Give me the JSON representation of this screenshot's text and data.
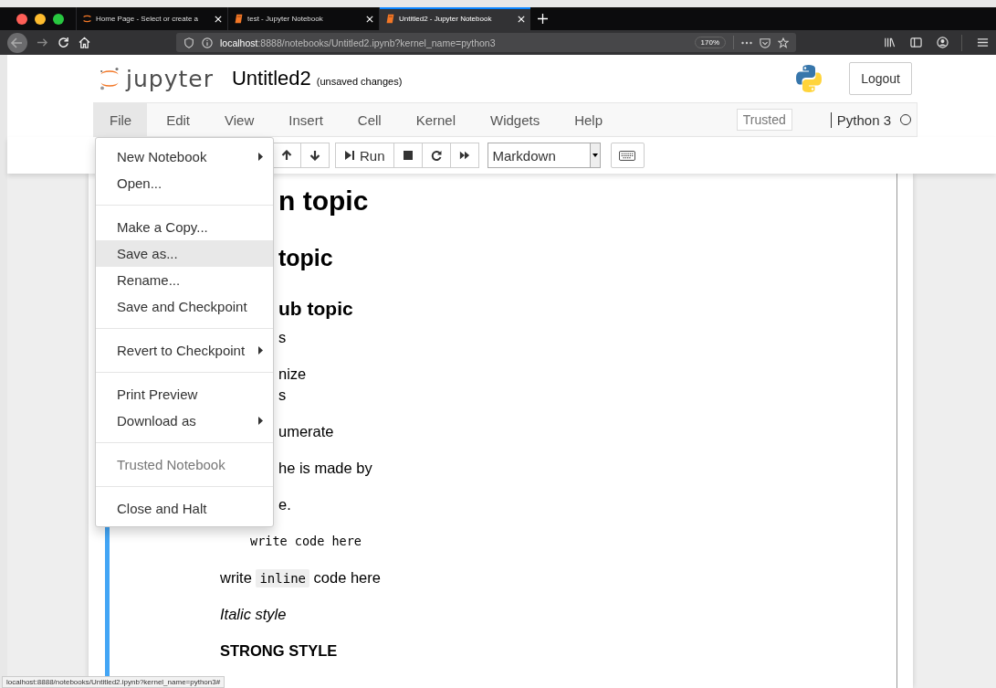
{
  "browser": {
    "tabs": [
      {
        "title": "Home Page - Select or create a",
        "kind": "jupyter",
        "selected": false
      },
      {
        "title": "test - Jupyter Notebook",
        "kind": "notebook",
        "selected": false
      },
      {
        "title": "Untitled2 - Jupyter Notebook",
        "kind": "notebook",
        "selected": true
      }
    ],
    "url_host": "localhost",
    "url_path": ":8888/notebooks/Untitled2.ipynb?kernel_name=python3",
    "zoom": "170%"
  },
  "header": {
    "logo_text": "jupyter",
    "notebook_name": "Untitled2",
    "save_status": "(unsaved changes)",
    "logout": "Logout"
  },
  "menubar": {
    "items": [
      {
        "label": "File",
        "selected": true
      },
      {
        "label": "Edit",
        "selected": false
      },
      {
        "label": "View",
        "selected": false
      },
      {
        "label": "Insert",
        "selected": false
      },
      {
        "label": "Cell",
        "selected": false
      },
      {
        "label": "Kernel",
        "selected": false
      },
      {
        "label": "Widgets",
        "selected": false
      },
      {
        "label": "Help",
        "selected": false
      }
    ],
    "trusted": "Trusted",
    "kernel": "Python 3"
  },
  "toolbar": {
    "run": "Run",
    "cell_type": "Markdown"
  },
  "file_menu": [
    [
      {
        "label": "New Notebook",
        "submenu": true,
        "disabled": false,
        "selected": false
      },
      {
        "label": "Open...",
        "submenu": false,
        "disabled": false,
        "selected": false
      }
    ],
    [
      {
        "label": "Make a Copy...",
        "submenu": false,
        "disabled": false,
        "selected": false
      },
      {
        "label": "Save as...",
        "submenu": false,
        "disabled": false,
        "selected": true
      },
      {
        "label": "Rename...",
        "submenu": false,
        "disabled": false,
        "selected": false
      },
      {
        "label": "Save and Checkpoint",
        "submenu": false,
        "disabled": false,
        "selected": false
      }
    ],
    [
      {
        "label": "Revert to Checkpoint",
        "submenu": true,
        "disabled": false,
        "selected": false
      }
    ],
    [
      {
        "label": "Print Preview",
        "submenu": false,
        "disabled": false,
        "selected": false
      },
      {
        "label": "Download as",
        "submenu": true,
        "disabled": false,
        "selected": false
      }
    ],
    [
      {
        "label": "Trusted Notebook",
        "submenu": false,
        "disabled": true,
        "selected": false
      }
    ],
    [
      {
        "label": "Close and Halt",
        "submenu": false,
        "disabled": false,
        "selected": false
      }
    ]
  ],
  "notebook": {
    "partly_covered_cells": [
      {
        "kind": "h1",
        "text": "n topic"
      },
      {
        "kind": "h2",
        "text": "topic"
      },
      {
        "kind": "h3",
        "text": "ub topic"
      },
      {
        "kind": "p",
        "text": "s"
      },
      {
        "kind": "p",
        "text": "nize"
      },
      {
        "kind": "cont",
        "text": "s"
      },
      {
        "kind": "p",
        "text": "umerate"
      },
      {
        "kind": "p",
        "text": "he is made by"
      },
      {
        "kind": "p",
        "text": "e."
      }
    ],
    "cells": [
      {
        "kind": "code",
        "text": "write code here"
      },
      {
        "kind": "inline",
        "before": "write ",
        "code": "inline",
        "after": " code here"
      },
      {
        "kind": "italic",
        "text": "Italic style"
      },
      {
        "kind": "strong",
        "text": "STRONG STYLE"
      }
    ]
  },
  "status_url": "localhost:8888/notebooks/Untitled2.ipynb?kernel_name=python3#"
}
